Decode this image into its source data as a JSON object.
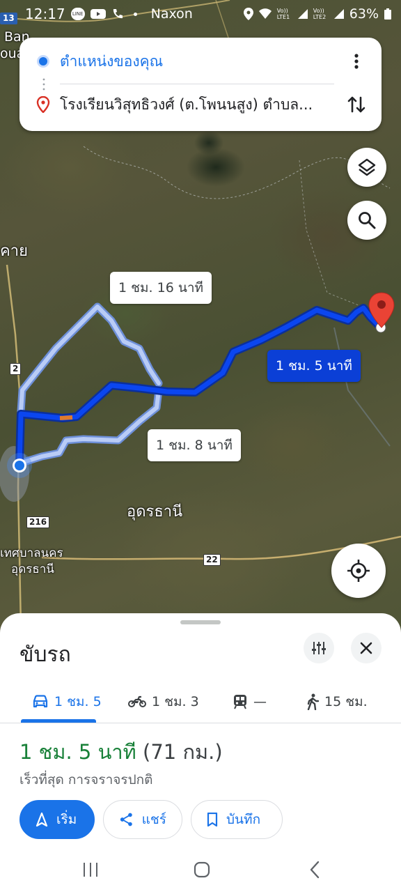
{
  "status_bar": {
    "time": "12:17",
    "place": "Naxon",
    "lte1": "Vo)) LTE1",
    "lte2": "Vo)) LTE2",
    "battery": "63%"
  },
  "map": {
    "labels": {
      "ban": "Ban",
      "ouax": "ouax",
      "khai": "คาย",
      "udon": "อุดรธานี",
      "muni1": "เทศบาลนคร",
      "muni2": "อุดรธานี"
    },
    "road_shields": {
      "r13": "13",
      "r2": "2",
      "r216": "216",
      "r22": "22"
    }
  },
  "directions": {
    "origin": "ตำแหน่งของคุณ",
    "destination": "โรงเรียนวิสุทธิวงศ์ (ต.โพนนสูง) ตำบล...",
    "colors": {
      "origin_dot": "#1a73e8",
      "destination_pin": "#d93025"
    }
  },
  "routes": [
    {
      "label": "1 ชม. 16 นาที",
      "selected": false
    },
    {
      "label": "1 ชม. 5 นาที",
      "selected": true
    },
    {
      "label": "1 ชม. 8 นาที",
      "selected": false
    }
  ],
  "sheet": {
    "title": "ขับรถ",
    "modes": [
      {
        "icon": "car-icon",
        "label": "1 ชม. 5",
        "active": true
      },
      {
        "icon": "motorcycle-icon",
        "label": "1 ชม. 3",
        "active": false
      },
      {
        "icon": "transit-icon",
        "label": "—",
        "active": false
      },
      {
        "icon": "walk-icon",
        "label": "15 ชม.",
        "active": false
      }
    ],
    "summary_time": "1 ชม. 5 นาที",
    "summary_distance": "(71 กม.)",
    "subtitle": "เร็วที่สุด การจราจรปกติ",
    "actions": {
      "start": "เริ่ม",
      "share": "แชร์",
      "save": "บันทึก"
    }
  },
  "colors": {
    "accent": "#1a73e8",
    "route_primary": "#0b3fd6",
    "route_alt": "#a8c1f4",
    "summary_green": "#188038"
  }
}
